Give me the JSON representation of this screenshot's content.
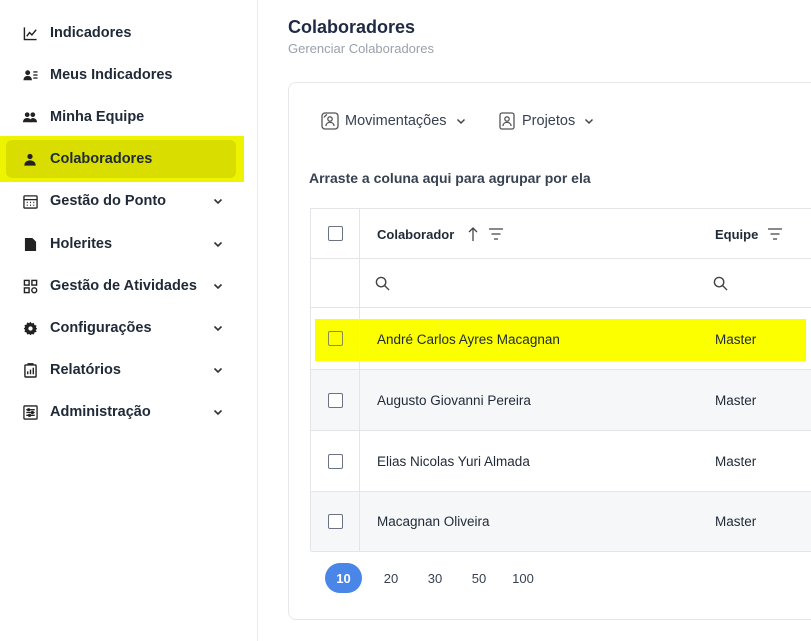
{
  "sidebar": {
    "items": [
      {
        "label": "Indicadores",
        "icon": "trend-chart-icon",
        "expandable": false,
        "active": false
      },
      {
        "label": "Meus Indicadores",
        "icon": "user-list-icon",
        "expandable": false,
        "active": false
      },
      {
        "label": "Minha Equipe",
        "icon": "users-icon",
        "expandable": false,
        "active": false
      },
      {
        "label": "Colaboradores",
        "icon": "user-icon",
        "expandable": false,
        "active": true
      },
      {
        "label": "Gestão do Ponto",
        "icon": "calendar-icon",
        "expandable": true,
        "active": false
      },
      {
        "label": "Holerites",
        "icon": "document-icon",
        "expandable": true,
        "active": false
      },
      {
        "label": "Gestão de Atividades",
        "icon": "apps-icon",
        "expandable": true,
        "active": false
      },
      {
        "label": "Configurações",
        "icon": "gear-icon",
        "expandable": true,
        "active": false
      },
      {
        "label": "Relatórios",
        "icon": "report-icon",
        "expandable": true,
        "active": false
      },
      {
        "label": "Administração",
        "icon": "sliders-icon",
        "expandable": true,
        "active": false
      }
    ]
  },
  "header": {
    "title": "Colaboradores",
    "subtitle": "Gerenciar Colaboradores"
  },
  "toolbar": {
    "movimentacoes_label": "Movimentações",
    "projetos_label": "Projetos"
  },
  "grid": {
    "group_hint": "Arraste a coluna aqui para agrupar por ela",
    "columns": {
      "colaborador": "Colaborador",
      "equipe": "Equipe"
    },
    "rows": [
      {
        "colaborador": "André Carlos Ayres Macagnan",
        "equipe": "Master",
        "highlighted": true
      },
      {
        "colaborador": "Augusto Giovanni Pereira",
        "equipe": "Master",
        "highlighted": false
      },
      {
        "colaborador": "Elias Nicolas Yuri Almada",
        "equipe": "Master",
        "highlighted": false
      },
      {
        "colaborador": "Macagnan Oliveira",
        "equipe": "Master",
        "highlighted": false
      }
    ]
  },
  "pager": {
    "sizes": [
      "10",
      "20",
      "30",
      "50",
      "100"
    ],
    "selected": "10"
  },
  "colors": {
    "highlight": "#fbff00",
    "active_nav": "#d9dd00",
    "accent": "#4a86e8"
  }
}
